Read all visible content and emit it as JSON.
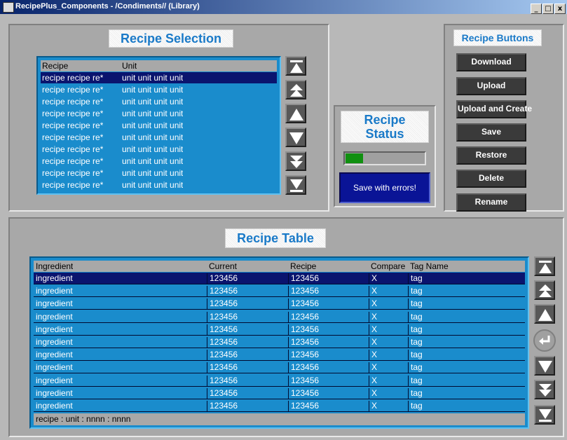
{
  "window": {
    "title": "RecipePlus_Components - /Condiments// (Library)",
    "controls": [
      "_",
      "□",
      "x"
    ]
  },
  "recipe_selection": {
    "title": "Recipe Selection",
    "headers": [
      "Recipe",
      "Unit"
    ],
    "rows": [
      {
        "recipe": "recipe recipe re*",
        "unit": "unit unit unit unit",
        "selected": true
      },
      {
        "recipe": "recipe recipe re*",
        "unit": "unit unit unit unit"
      },
      {
        "recipe": "recipe recipe re*",
        "unit": "unit unit unit unit"
      },
      {
        "recipe": "recipe recipe re*",
        "unit": "unit unit unit unit"
      },
      {
        "recipe": "recipe recipe re*",
        "unit": "unit unit unit unit"
      },
      {
        "recipe": "recipe recipe re*",
        "unit": "unit unit unit unit"
      },
      {
        "recipe": "recipe recipe re*",
        "unit": "unit unit unit unit"
      },
      {
        "recipe": "recipe recipe re*",
        "unit": "unit unit unit unit"
      },
      {
        "recipe": "recipe recipe re*",
        "unit": "unit unit unit unit"
      },
      {
        "recipe": "recipe recipe re*",
        "unit": "unit unit unit unit"
      }
    ]
  },
  "recipe_status": {
    "title_line1": "Recipe",
    "title_line2": "Status",
    "progress": 0.22,
    "progress_color": "#109010",
    "message": "Save with errors!"
  },
  "recipe_buttons": {
    "title": "Recipe Buttons",
    "buttons": [
      "Download",
      "Upload",
      "Upload and Create",
      "Save",
      "Restore",
      "Delete",
      "Rename"
    ]
  },
  "recipe_table": {
    "title": "Recipe Table",
    "headers": [
      "Ingredient",
      "Current",
      "Recipe",
      "Compare",
      "Tag Name"
    ],
    "rows": [
      {
        "ingredient": "ingredient",
        "current": "123456",
        "recipe": "123456",
        "compare": "X",
        "tag": "tag",
        "selected": true
      },
      {
        "ingredient": "ingredient",
        "current": "123456",
        "recipe": "123456",
        "compare": "X",
        "tag": "tag"
      },
      {
        "ingredient": "ingredient",
        "current": "123456",
        "recipe": "123456",
        "compare": "X",
        "tag": "tag"
      },
      {
        "ingredient": "ingredient",
        "current": "123456",
        "recipe": "123456",
        "compare": "X",
        "tag": "tag"
      },
      {
        "ingredient": "ingredient",
        "current": "123456",
        "recipe": "123456",
        "compare": "X",
        "tag": "tag"
      },
      {
        "ingredient": "ingredient",
        "current": "123456",
        "recipe": "123456",
        "compare": "X",
        "tag": "tag"
      },
      {
        "ingredient": "ingredient",
        "current": "123456",
        "recipe": "123456",
        "compare": "X",
        "tag": "tag"
      },
      {
        "ingredient": "ingredient",
        "current": "123456",
        "recipe": "123456",
        "compare": "X",
        "tag": "tag"
      },
      {
        "ingredient": "ingredient",
        "current": "123456",
        "recipe": "123456",
        "compare": "X",
        "tag": "tag"
      },
      {
        "ingredient": "ingredient",
        "current": "123456",
        "recipe": "123456",
        "compare": "X",
        "tag": "tag"
      },
      {
        "ingredient": "ingredient",
        "current": "123456",
        "recipe": "123456",
        "compare": "X",
        "tag": "tag"
      }
    ],
    "footer": "recipe : unit : nnnn : nnnn"
  },
  "colors": {
    "list_background": "#1a8ccc",
    "selected_row": "#0a146e",
    "title_text": "#1a7ac8",
    "status_box": "#0a1496"
  },
  "icons": {
    "nav_selection": [
      "move-first-icon",
      "page-up-icon",
      "move-up-icon",
      "move-down-icon",
      "page-down-icon",
      "move-last-icon"
    ],
    "nav_table": [
      "move-first-icon",
      "page-up-icon",
      "move-up-icon",
      "enter-icon",
      "move-down-icon",
      "page-down-icon",
      "move-last-icon"
    ]
  }
}
